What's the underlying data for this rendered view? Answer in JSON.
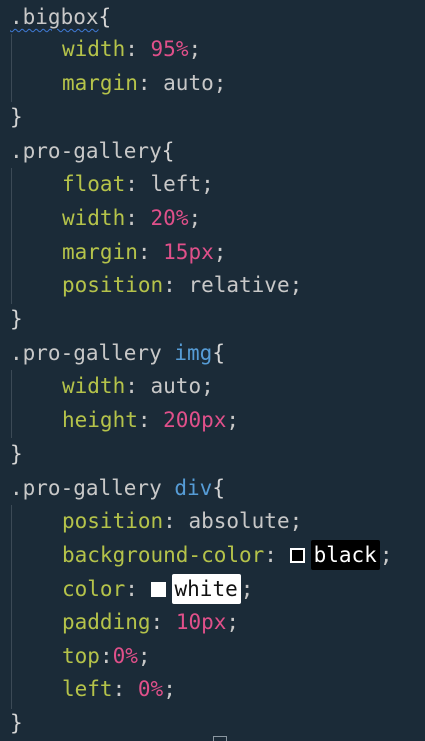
{
  "code": {
    "bigbox": {
      "selector": ".bigbox",
      "open": "{",
      "width_prop": "width",
      "width_num": "95",
      "width_unit": "%",
      "margin_prop": "margin",
      "margin_val": "auto",
      "close": "}"
    },
    "pro_gallery": {
      "selector": ".pro-gallery",
      "open": "{",
      "float_prop": "float",
      "float_val": "left",
      "width_prop": "width",
      "width_num": "20",
      "width_unit": "%",
      "margin_prop": "margin",
      "margin_num": "15",
      "margin_unit": "px",
      "position_prop": "position",
      "position_val": "relative",
      "close": "}"
    },
    "pro_gallery_img": {
      "selector": ".pro-gallery ",
      "tag": "img",
      "open": "{",
      "width_prop": "width",
      "width_val": "auto",
      "height_prop": "height",
      "height_num": "200",
      "height_unit": "px",
      "close": "}"
    },
    "pro_gallery_div": {
      "selector": ".pro-gallery ",
      "tag": "div",
      "open": "{",
      "position_prop": "position",
      "position_val": "absolute",
      "bg_prop": "background-color",
      "bg_val": "black",
      "color_prop": "color",
      "color_val": "white",
      "padding_prop": "padding",
      "padding_num": "10",
      "padding_unit": "px",
      "top_prop": "top",
      "top_num": "0",
      "top_unit": "%",
      "left_prop": "left",
      "left_num": "0",
      "left_unit": "%",
      "close": "}"
    }
  },
  "colors": {
    "background": "#1b2b38",
    "property": "#b5c34a",
    "number": "#e0508a",
    "tag": "#569cd6",
    "text": "#c8c8c8"
  }
}
